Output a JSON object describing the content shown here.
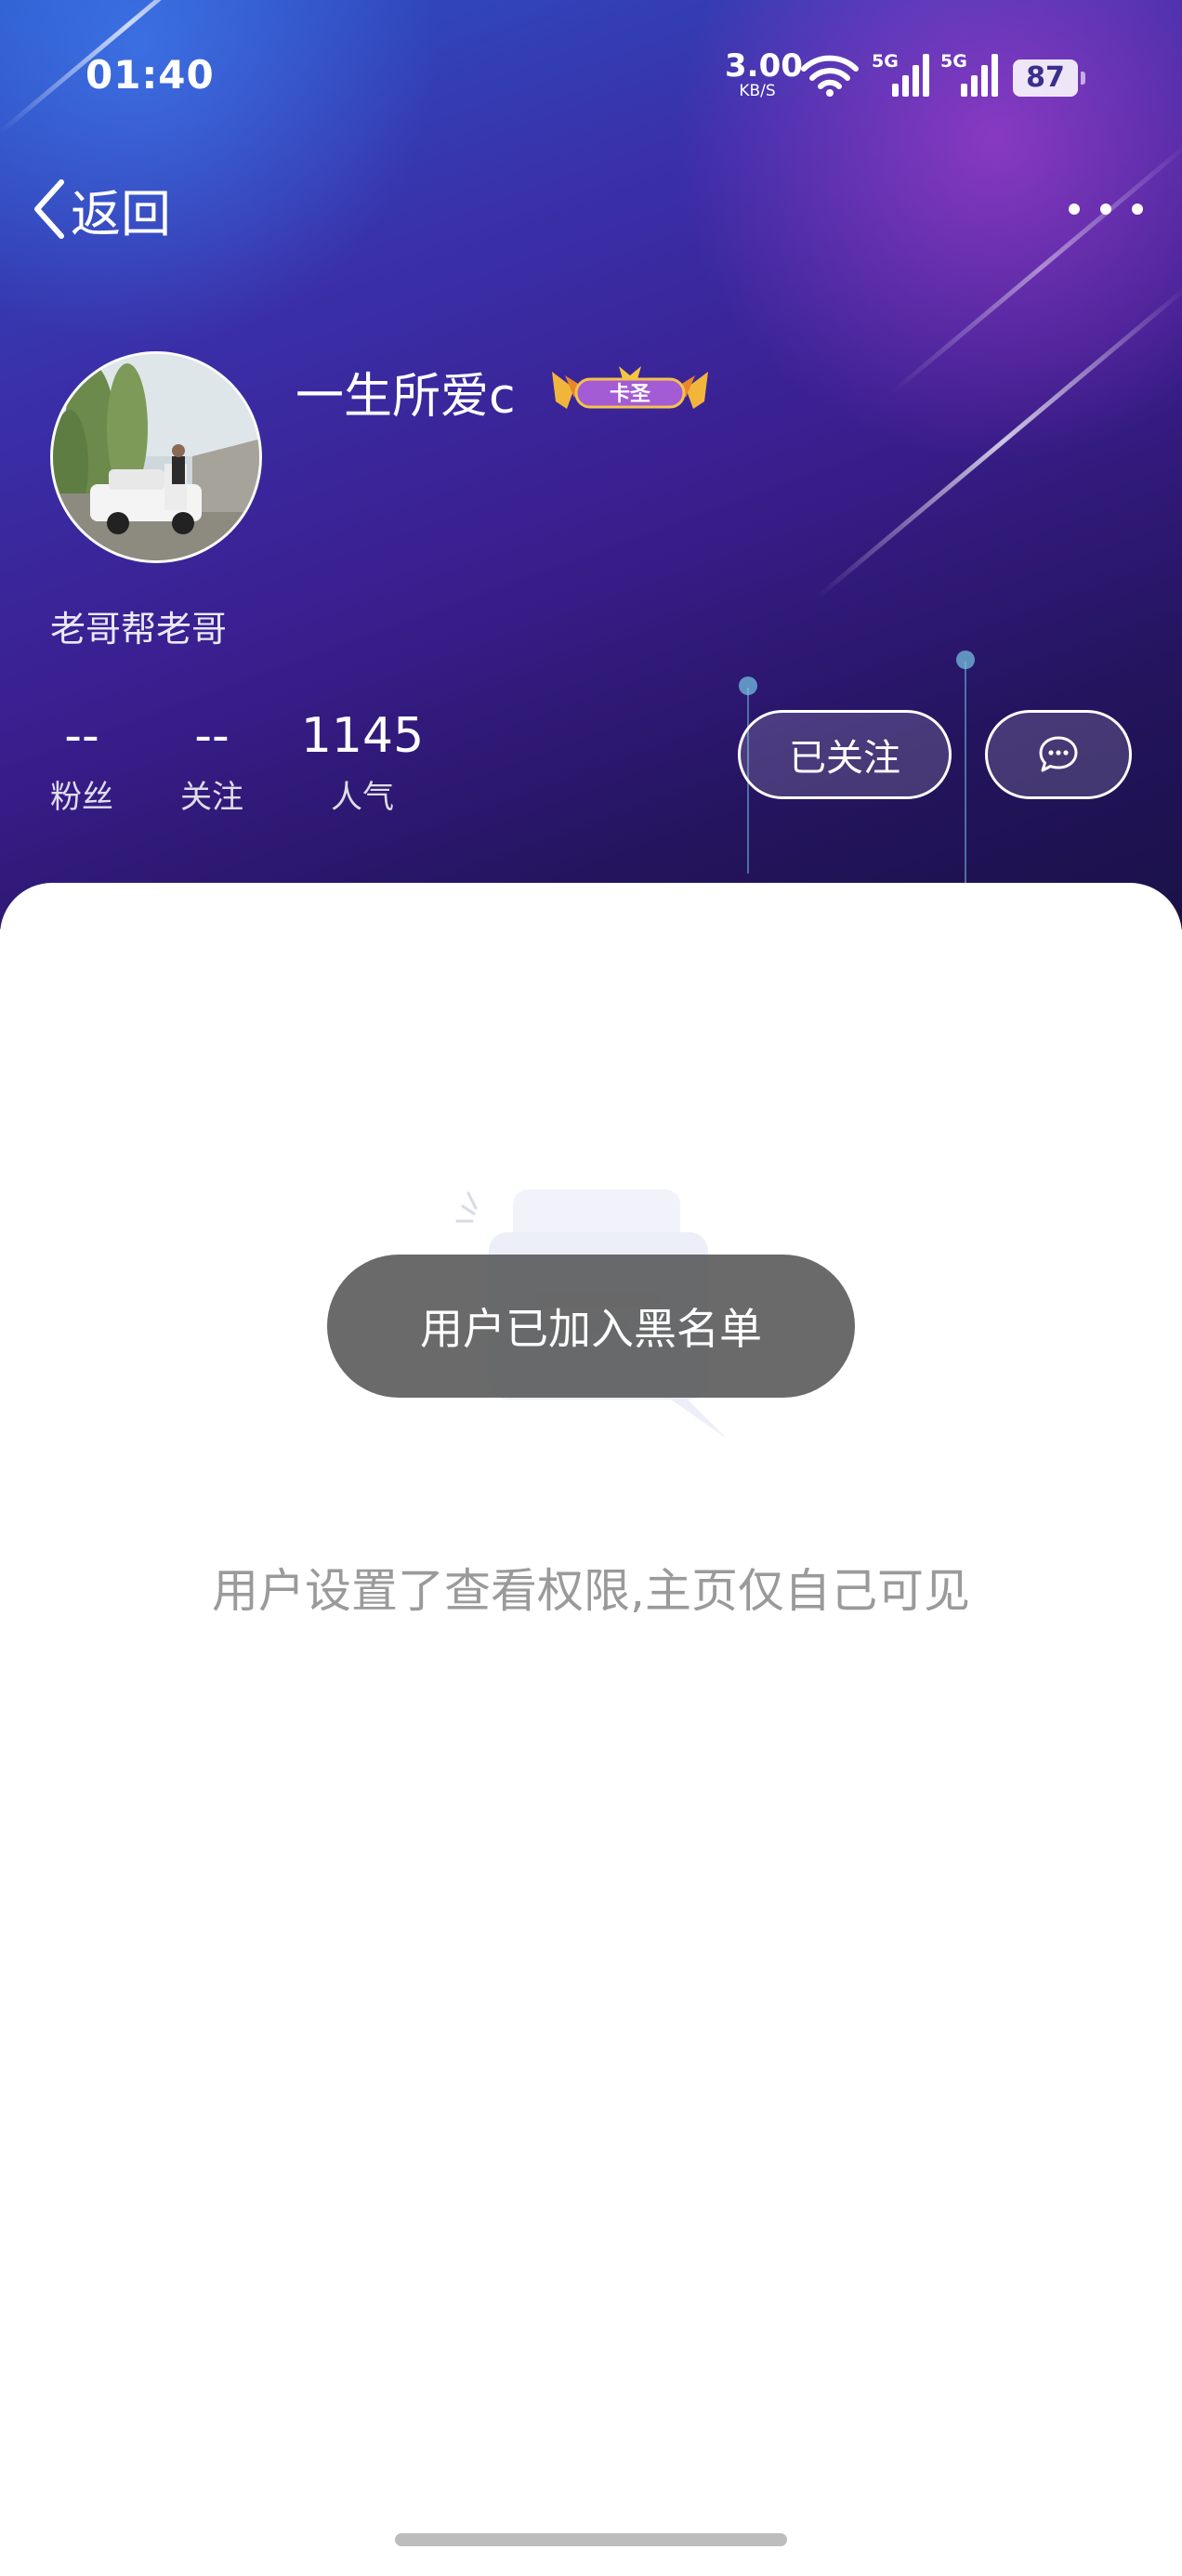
{
  "status_bar": {
    "time": "01:40",
    "net_speed_value": "3.00",
    "net_speed_unit": "KB/S",
    "signal_1_label": "5G",
    "signal_2_label": "5G",
    "battery": "87"
  },
  "nav": {
    "back_label": "返回",
    "more_icon": "more-dots-icon"
  },
  "profile": {
    "username": "一生所爱c",
    "badge_text": "卡圣",
    "bio": "老哥帮老哥"
  },
  "stats": [
    {
      "value": "--",
      "label": "粉丝"
    },
    {
      "value": "--",
      "label": "关注"
    },
    {
      "value": "1145",
      "label": "人气"
    }
  ],
  "actions": {
    "follow_label": "已关注",
    "message_icon": "chat-bubble-icon"
  },
  "content": {
    "empty_message": "用户设置了查看权限,主页仅自己可见",
    "toast": "用户已加入黑名单"
  },
  "colors": {
    "header_blue": "#2a54c6",
    "header_purple": "#3a1e8e",
    "toast_bg": "#5a5a5a",
    "empty_text": "#9a9a9a"
  }
}
